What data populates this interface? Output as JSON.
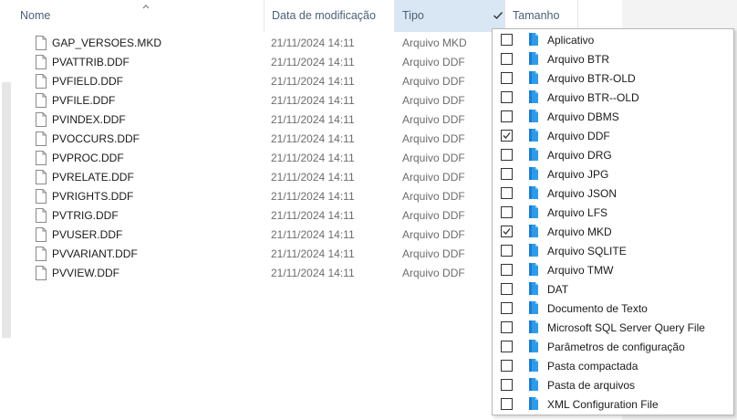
{
  "header": {
    "name_label": "Nome",
    "date_label": "Data de modificação",
    "type_label": "Tipo",
    "size_label": "Tamanho"
  },
  "files": [
    {
      "name": "GAP_VERSOES.MKD",
      "date": "21/11/2024 14:11",
      "type": "Arquivo MKD"
    },
    {
      "name": "PVATTRIB.DDF",
      "date": "21/11/2024 14:11",
      "type": "Arquivo DDF"
    },
    {
      "name": "PVFIELD.DDF",
      "date": "21/11/2024 14:11",
      "type": "Arquivo DDF"
    },
    {
      "name": "PVFILE.DDF",
      "date": "21/11/2024 14:11",
      "type": "Arquivo DDF"
    },
    {
      "name": "PVINDEX.DDF",
      "date": "21/11/2024 14:11",
      "type": "Arquivo DDF"
    },
    {
      "name": "PVOCCURS.DDF",
      "date": "21/11/2024 14:11",
      "type": "Arquivo DDF"
    },
    {
      "name": "PVPROC.DDF",
      "date": "21/11/2024 14:11",
      "type": "Arquivo DDF"
    },
    {
      "name": "PVRELATE.DDF",
      "date": "21/11/2024 14:11",
      "type": "Arquivo DDF"
    },
    {
      "name": "PVRIGHTS.DDF",
      "date": "21/11/2024 14:11",
      "type": "Arquivo DDF"
    },
    {
      "name": "PVTRIG.DDF",
      "date": "21/11/2024 14:11",
      "type": "Arquivo DDF"
    },
    {
      "name": "PVUSER.DDF",
      "date": "21/11/2024 14:11",
      "type": "Arquivo DDF"
    },
    {
      "name": "PVVARIANT.DDF",
      "date": "21/11/2024 14:11",
      "type": "Arquivo DDF"
    },
    {
      "name": "PVVIEW.DDF",
      "date": "21/11/2024 14:11",
      "type": "Arquivo DDF"
    }
  ],
  "filter": {
    "items": [
      {
        "label": "Aplicativo",
        "checked": false
      },
      {
        "label": "Arquivo BTR",
        "checked": false
      },
      {
        "label": "Arquivo BTR-OLD",
        "checked": false
      },
      {
        "label": "Arquivo BTR--OLD",
        "checked": false
      },
      {
        "label": "Arquivo DBMS",
        "checked": false
      },
      {
        "label": "Arquivo DDF",
        "checked": true
      },
      {
        "label": "Arquivo DRG",
        "checked": false
      },
      {
        "label": "Arquivo JPG",
        "checked": false
      },
      {
        "label": "Arquivo JSON",
        "checked": false
      },
      {
        "label": "Arquivo LFS",
        "checked": false
      },
      {
        "label": "Arquivo MKD",
        "checked": true
      },
      {
        "label": "Arquivo SQLITE",
        "checked": false
      },
      {
        "label": "Arquivo TMW",
        "checked": false
      },
      {
        "label": "DAT",
        "checked": false
      },
      {
        "label": "Documento de Texto",
        "checked": false
      },
      {
        "label": "Microsoft SQL Server Query File",
        "checked": false
      },
      {
        "label": "Parâmetros de configuração",
        "checked": false
      },
      {
        "label": "Pasta compactada",
        "checked": false
      },
      {
        "label": "Pasta de arquivos",
        "checked": false
      },
      {
        "label": "XML Configuration File",
        "checked": false
      }
    ]
  },
  "icons": {
    "file": "document-icon",
    "filter_item": "file-type-icon",
    "sort": "chevron-up-icon",
    "filter_active": "checkmark-icon"
  },
  "colors": {
    "header_text": "#4c607a",
    "header_active_bg": "#d9e7f5",
    "icon_blue": "#2f9be8",
    "muted_text": "#6d6d6d"
  }
}
